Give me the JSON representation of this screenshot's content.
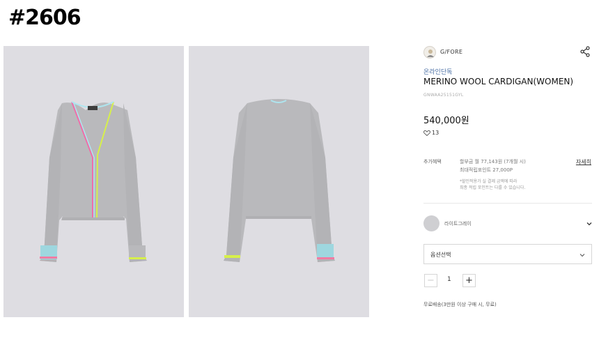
{
  "label": "#2606",
  "product": {
    "brand": "G/FORE",
    "tag": "온라인단독",
    "title": "MERINO WOOL CARDIGAN(WOMEN)",
    "code": "GNWAA25151GYL",
    "price": "540,000원",
    "likes": "13",
    "images": [
      {
        "view": "front",
        "color": "#dedde2"
      },
      {
        "view": "back",
        "color": "#dedde2"
      }
    ]
  },
  "benefits": {
    "label": "추가혜택",
    "details_link": "자세히",
    "installment": "할부금 월 77,143원 (7개월 시)",
    "points": "최대적립포인트 27,000P",
    "note_line1": "*할인적용가 실 결제 금액에 따라",
    "note_line2": "최종 적립 포인트는 다를 수 있습니다."
  },
  "color_option": {
    "name": "라이트그레이",
    "swatch": "#cfcfd2"
  },
  "option_select": {
    "placeholder": "옵션선택"
  },
  "quantity": {
    "value": "1"
  },
  "shipping": "무료배송(3만원 이상 구매 시, 무료)",
  "colors": {
    "link": "#4a6fa5",
    "photo_bg": "#dedde2",
    "garment": "#b8b8bb"
  }
}
